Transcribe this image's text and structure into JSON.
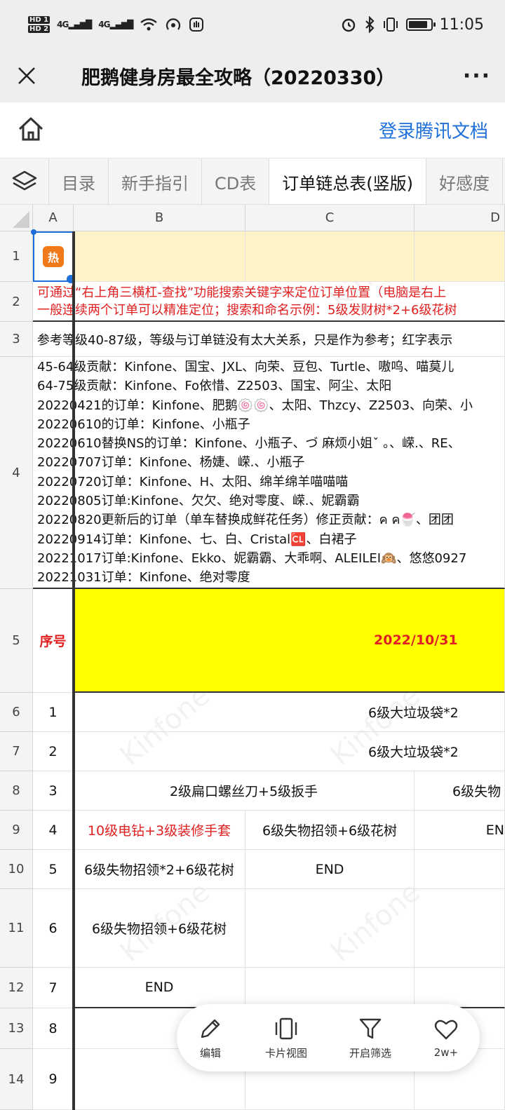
{
  "status_bar": {
    "hd1": "HD 1",
    "hd2": "HD 2",
    "sig1": "4G",
    "sig2": "4G",
    "time": "11:05"
  },
  "title_bar": {
    "title": "肥鹅健身房最全攻略（20220330）",
    "more": "···"
  },
  "header": {
    "login": "登录腾讯文档"
  },
  "tabs": [
    "目录",
    "新手指引",
    "CD表",
    "订单链总表(竖版)",
    "好感度"
  ],
  "columns": [
    "A",
    "B",
    "C",
    "D"
  ],
  "rows": [
    "1",
    "2",
    "3",
    "4",
    "5",
    "6",
    "7",
    "8",
    "9",
    "10",
    "11",
    "12",
    "13",
    "14"
  ],
  "cells": {
    "a1_badge": "热",
    "r2_line1": "可通过“右上角三横杠-查找”功能搜索关键字来定位订单位置（电脑是右上",
    "r2_line2": "一般连续两个订单可以精准定位；搜索和命名示例：5级发财树*2+6级花树",
    "r3": "参考等级40-87级，等级与订单链没有太大关系，只是作为参考；红字表示",
    "r4_lines": [
      "45-64级贡献：Kinfone、国宝、JXL、向荣、豆包、Turtle、嗷呜、喵莫儿",
      "64-75级贡献：Kinfone、Fo依惜、Z2503、国宝、阿尘、太阳",
      "20220421的订单：Kinfone、肥鹅🍥🍥、太阳、Thzcy、Z2503、向荣、小",
      "20220610的订单：Kinfone、小瓶子",
      "20220610替换NS的订单：Kinfone、小瓶子、づ 麻烦小姐ˇ 。、嵘.、RE、",
      "20220707订单：Kinfone、杨婕、嵘.、小瓶子",
      "20220720订单：Kinfone、H、太阳、绵羊绵羊喵喵喵",
      "20220805订单:Kinfone、欠欠、绝对零度、嵘.、妮霸霸",
      "20220820更新后的订单（单车替换成鲜花任务）修正贡献：ค ค🍧、团团",
      "20220914订单：Kinfone、七、白、Cristal🆑、白裙子",
      "20221017订单:Kinfone、Ekko、妮霸霸、大乖啊、ALEILEI🙉、悠悠0927",
      "20221031订单：Kinfone、绝对零度"
    ],
    "r5_label": "序号",
    "r5_date": "2022/10/31",
    "r6_a": "1",
    "r6_b": "6级大垃圾袋*2",
    "r7_a": "2",
    "r7_b": "6级大垃圾袋*2",
    "r8_a": "3",
    "r8_b": "2级扁口螺丝刀+5级扳手",
    "r8_d": "6级失物",
    "r9_a": "4",
    "r9_b": "10级电钻+3级装修手套",
    "r9_c": "6级失物招领+6级花树",
    "r9_d": "EN",
    "r10_a": "5",
    "r10_b": "6级失物招领*2+6级花树",
    "r10_c": "END",
    "r11_a": "6",
    "r11_b": "6级失物招领+6级花树",
    "r12_a": "7",
    "r12_b": "END",
    "r13_a": "8",
    "r14_a": "9"
  },
  "toolbar": {
    "edit": "编辑",
    "card_view": "卡片视图",
    "filter": "开启筛选",
    "like": "2w+"
  },
  "colors": {
    "accent_blue": "#1e6fd9",
    "red_text": "#e02020",
    "highlight_yellow": "#ffff00",
    "header_pale_yellow": "#fdf3c6",
    "badge_orange": "#f07a1a"
  }
}
